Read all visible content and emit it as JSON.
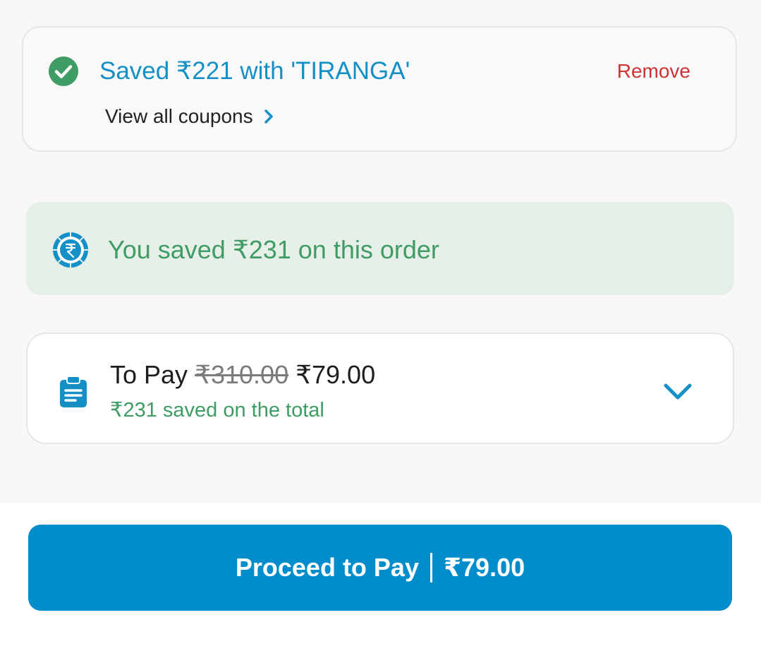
{
  "coupon": {
    "saved_text": "Saved ₹221 with 'TIRANGA'",
    "remove_label": "Remove",
    "view_all_label": "View all coupons",
    "check_icon": "check-circle-icon"
  },
  "savings_banner": {
    "text": "You saved ₹231 on this order",
    "icon": "rupee-coin-icon"
  },
  "pay_summary": {
    "label": "To Pay",
    "original_amount": "₹310.00",
    "final_amount": "₹79.00",
    "saved_text": "₹231 saved on the total",
    "icon": "clipboard-icon",
    "expand_icon": "chevron-down-icon"
  },
  "footer": {
    "button_label": "Proceed to Pay",
    "button_amount": "₹79.00"
  },
  "colors": {
    "accent_blue": "#018ccb",
    "success_green": "#3e9c64",
    "remove_red": "#cf3434",
    "banner_bg": "#e7efe9"
  }
}
